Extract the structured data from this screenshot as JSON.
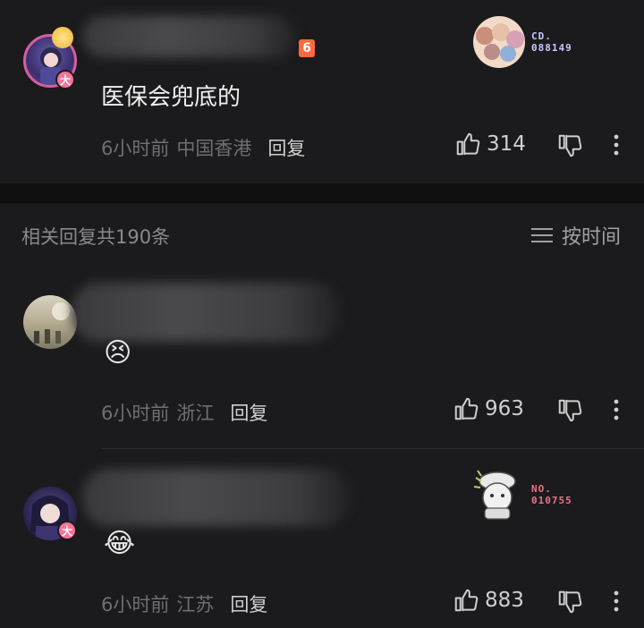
{
  "root_comment": {
    "text": "医保会兜底的",
    "time": "6小时前",
    "location": "中国香港",
    "reply_label": "回复",
    "likes": "314",
    "level_badge": "6",
    "avatar_badge": "大",
    "fan_badge": {
      "line1": "CD.",
      "line2": "088149",
      "color": "#bfc3ff"
    }
  },
  "replies_header": {
    "title": "相关回复共190条",
    "sort_label": "按时间"
  },
  "replies": [
    {
      "emoji": "😣",
      "time": "6小时前",
      "location": "浙江",
      "reply_label": "回复",
      "likes": "963"
    },
    {
      "emoji": "😂",
      "time": "6小时前",
      "location": "江苏",
      "reply_label": "回复",
      "likes": "883",
      "avatar_badge": "大",
      "fan_badge": {
        "line1": "NO.",
        "line2": "010755",
        "color": "#e8738a"
      }
    }
  ],
  "icons": {
    "like": "thumbs-up-icon",
    "dislike": "thumbs-down-icon",
    "more": "more-vertical-icon",
    "sort": "list-icon"
  }
}
